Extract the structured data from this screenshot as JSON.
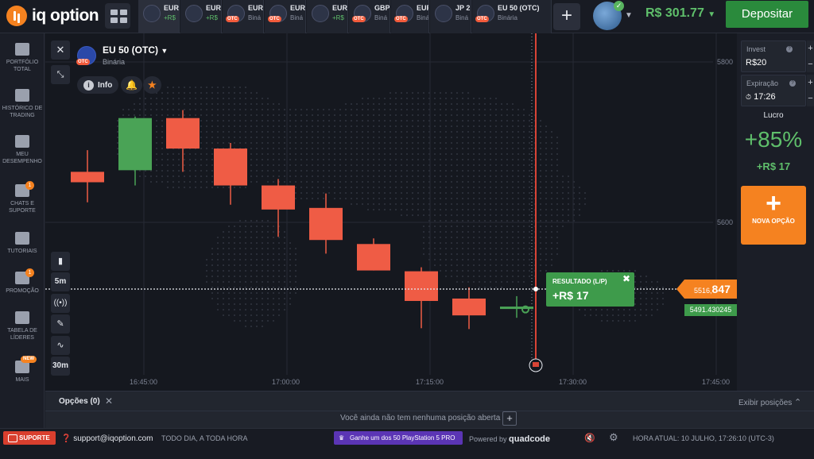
{
  "brand": {
    "name": "iq option"
  },
  "tabs": [
    {
      "name": "EUR",
      "sub": "+R$",
      "icon": "eurusd-flag-icon",
      "sub_green": true,
      "active": true
    },
    {
      "name": "EUR",
      "sub": "+R$",
      "icon": "eurusd-flag-icon",
      "sub_green": true
    },
    {
      "name": "EUR",
      "sub": "Biná",
      "icon": "eu-flag-icon",
      "otc": true
    },
    {
      "name": "EUR",
      "sub": "Biná",
      "icon": "eu-flag-icon",
      "otc": true
    },
    {
      "name": "EUR",
      "sub": "+R$",
      "icon": "eurusd-flag-icon",
      "sub_green": true
    },
    {
      "name": "GBP",
      "sub": "Biná",
      "icon": "uk-flag-icon",
      "otc": true
    },
    {
      "name": "EUR",
      "sub": "Biná",
      "icon": "eu-flag-icon",
      "otc": true
    },
    {
      "name": "JP 2",
      "sub": "Biná",
      "icon": "japan-flag-icon"
    },
    {
      "name": "EU 50 (OTC)",
      "sub": "Binária",
      "icon": "eu-flag-icon",
      "otc": true
    }
  ],
  "topbar": {
    "balance": "R$ 301.77",
    "deposit_label": "Depositar"
  },
  "sidebar": [
    {
      "id": "portfolio",
      "label": "PORTFÓLIO TOTAL"
    },
    {
      "id": "history",
      "label": "HISTÓRICO DE TRADING"
    },
    {
      "id": "performance",
      "label": "MEU DESEMPENHO"
    },
    {
      "id": "chats",
      "label": "CHATS E SUPORTE",
      "badge": "1"
    },
    {
      "id": "tutorials",
      "label": "TUTORIAIS"
    },
    {
      "id": "promo",
      "label": "PROMOÇÃO",
      "badge": "1"
    },
    {
      "id": "leaders",
      "label": "TABELA DE LÍDERES"
    },
    {
      "id": "more",
      "label": "MAIS",
      "new": "NEW"
    }
  ],
  "chart": {
    "asset_title": "EU 50 (OTC)",
    "asset_type": "Binária",
    "otc_badge": "OTC",
    "info_label": "Info",
    "timeframe": "5m",
    "period": "30m",
    "result_title": "RESULTADO (L/P)",
    "result_value": "+R$ 17",
    "current_price_prefix": "5516,",
    "current_price_suffix": "847",
    "strike_price": "5491.430245",
    "price_labels": [
      "5800",
      "5600"
    ],
    "time_labels": [
      "16:45:00",
      "17:00:00",
      "17:15:00",
      "17:30:00",
      "17:45:00"
    ]
  },
  "chart_data": {
    "type": "candlestick",
    "ylabel": "",
    "ylim": [
      5400,
      5800
    ],
    "candles": [
      {
        "o": 5663,
        "c": 5650,
        "h": 5690,
        "l": 5625
      },
      {
        "o": 5665,
        "c": 5730,
        "h": 5732,
        "l": 5646
      },
      {
        "o": 5730,
        "c": 5692,
        "h": 5740,
        "l": 5663
      },
      {
        "o": 5692,
        "c": 5646,
        "h": 5699,
        "l": 5622
      },
      {
        "o": 5646,
        "c": 5616,
        "h": 5654,
        "l": 5582
      },
      {
        "o": 5618,
        "c": 5578,
        "h": 5636,
        "l": 5561
      },
      {
        "o": 5573,
        "c": 5540,
        "h": 5580,
        "l": 5540
      },
      {
        "o": 5539,
        "c": 5502,
        "h": 5544,
        "l": 5468
      },
      {
        "o": 5505,
        "c": 5484,
        "h": 5519,
        "l": 5467
      },
      {
        "o": 5492,
        "c": 5495,
        "h": 5508,
        "l": 5481
      }
    ],
    "current_price": 5516.847,
    "strike_price": 5491.430245,
    "colors": {
      "up": "#4aa356",
      "down": "#ef5c45"
    }
  },
  "panel": {
    "invest_label": "Invest",
    "invest_value": "R$20",
    "expiry_label": "Expiração",
    "expiry_value": "17:26",
    "profit_label": "Lucro",
    "profit_pct": "+85%",
    "profit_amount": "+R$ 17",
    "new_option_label": "NOVA OPÇÃO"
  },
  "options": {
    "title": "Opções (0)",
    "empty_text": "Você ainda não tem nenhuma posição aberta",
    "show_positions": "Exibir posições"
  },
  "footer": {
    "support_label": "SUPORTE",
    "email": "support@iqoption.com",
    "hours": "TODO DIA, A TODA HORA",
    "promo": "Ganhe um dos 50 PlayStation 5 PRO",
    "powered_by": "Powered by",
    "powered_brand": "quadcode",
    "clock": "HORA ATUAL: 10 JULHO, 17:26:10 (UTC-3)"
  }
}
